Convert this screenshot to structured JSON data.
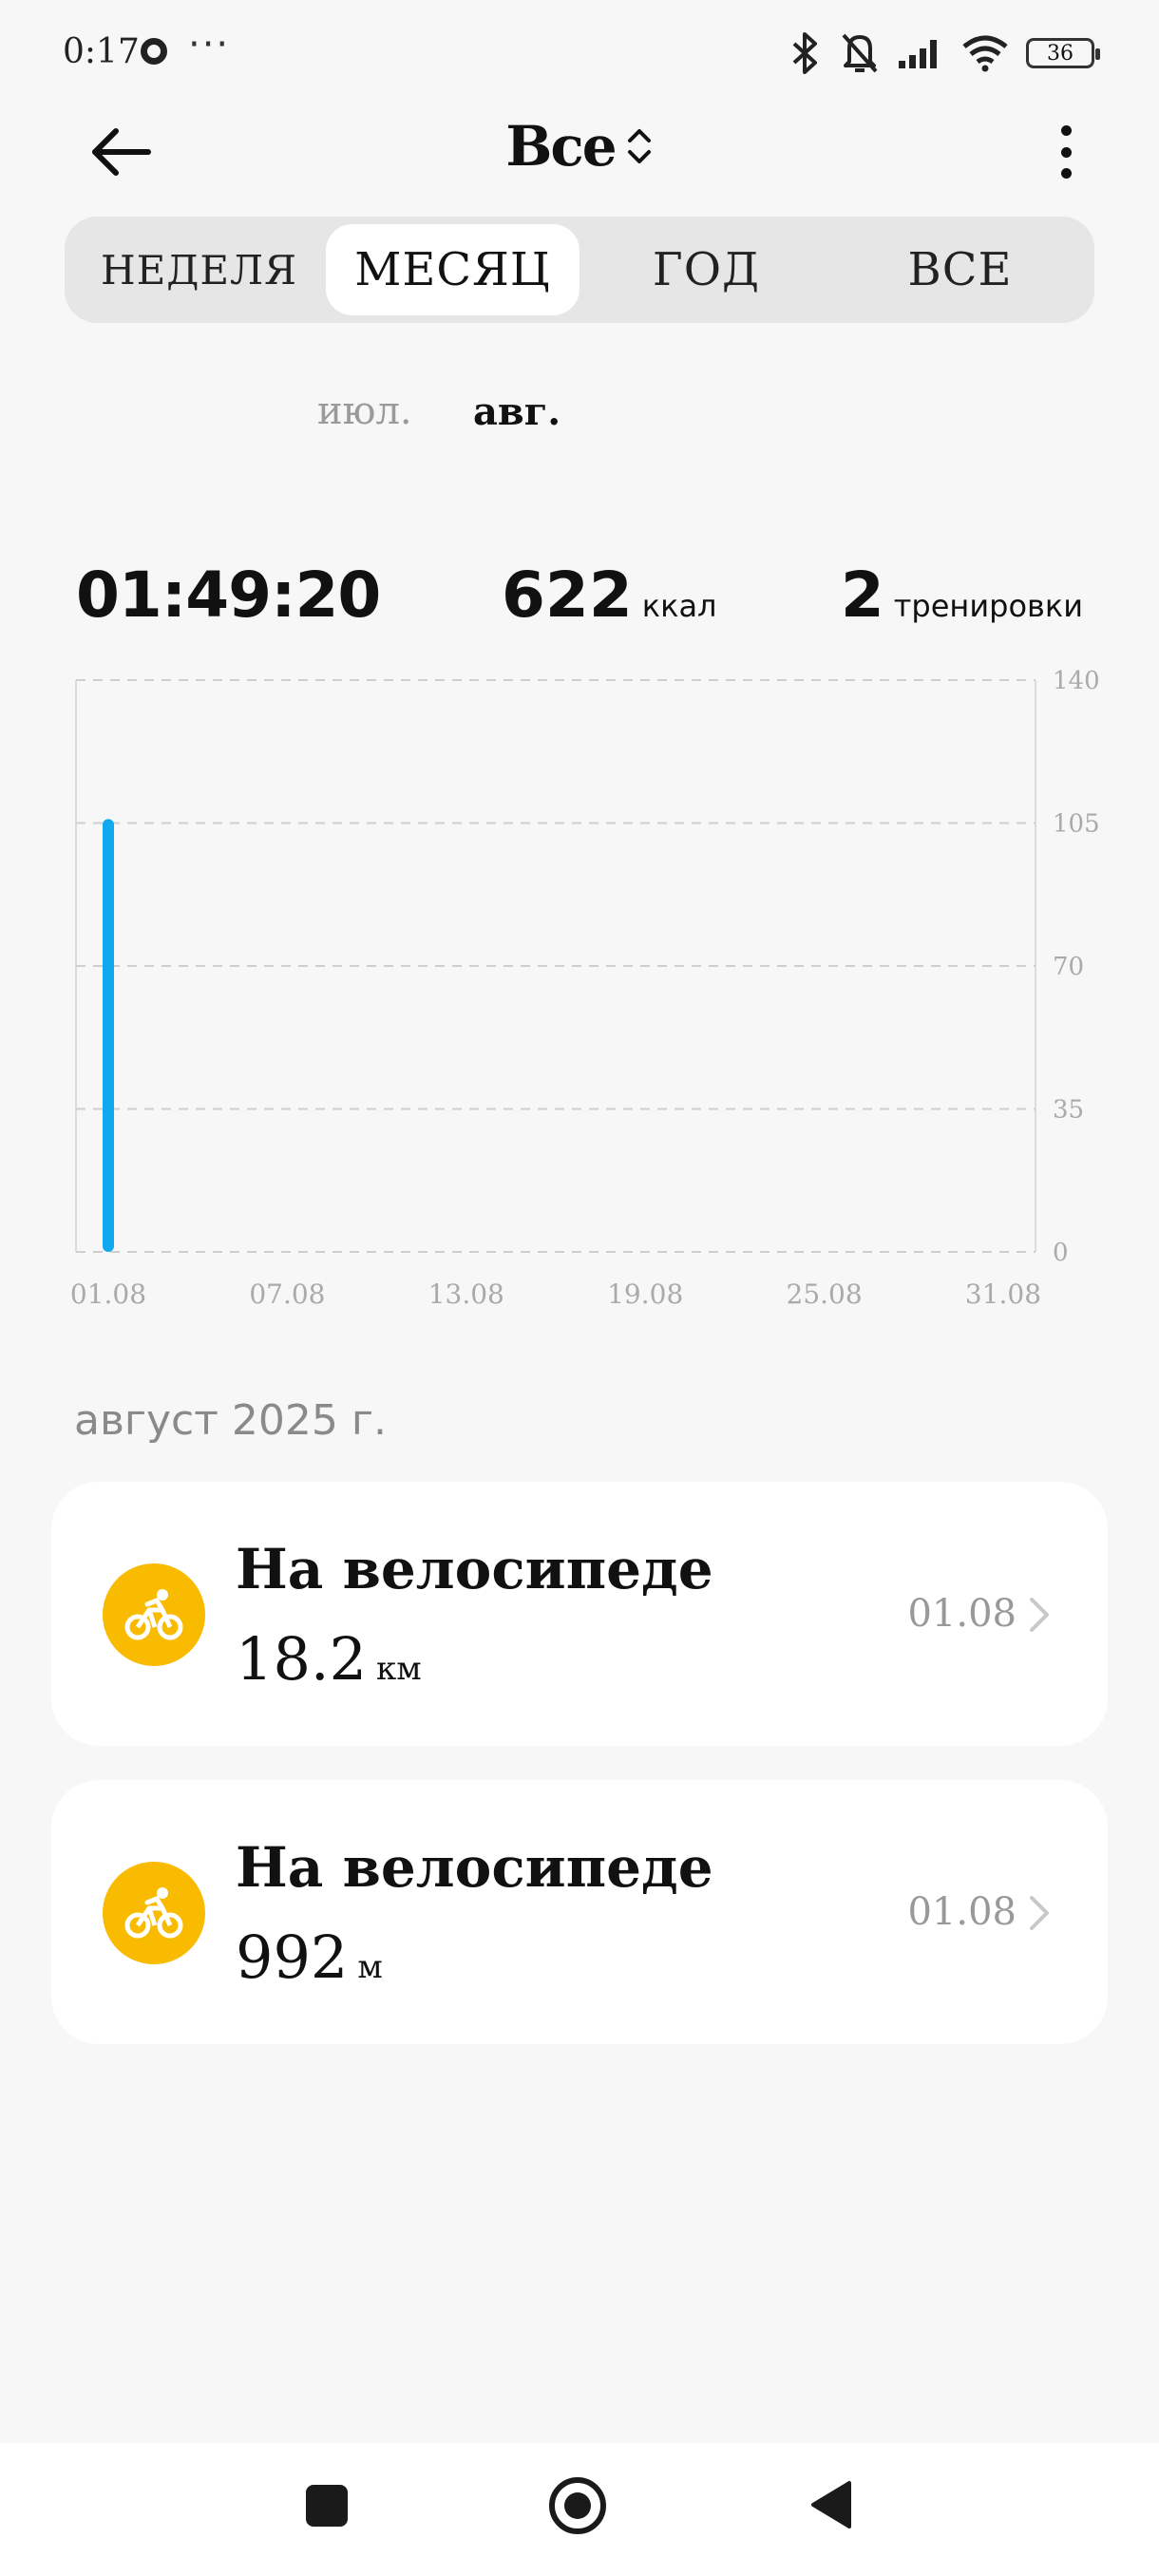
{
  "status_bar": {
    "time": "0:17",
    "more": "···",
    "battery": "36",
    "icons": [
      "bluetooth-icon",
      "bell-off-icon",
      "signal-icon",
      "wifi-icon",
      "battery-icon"
    ]
  },
  "header": {
    "title": "Все",
    "icons": [
      "back-arrow-icon",
      "sort-chevrons-icon",
      "more-vertical-icon"
    ]
  },
  "tabs": [
    {
      "label": "НЕДЕЛЯ",
      "active": false
    },
    {
      "label": "МЕСЯЦ",
      "active": true
    },
    {
      "label": "ГОД",
      "active": false
    },
    {
      "label": "ВСЕ",
      "active": false
    }
  ],
  "months": {
    "prev": "июл.",
    "current": "авг."
  },
  "stats": {
    "duration": "01:49:20",
    "calories": "622",
    "calories_unit": "ккал",
    "workouts": "2",
    "workouts_unit": "тренировки"
  },
  "chart_data": {
    "type": "bar",
    "categories": [
      "01.08"
    ],
    "values": [
      106
    ],
    "x_ticks": [
      "01.08",
      "07.08",
      "13.08",
      "19.08",
      "25.08",
      "31.08"
    ],
    "y_ticks": [
      0,
      35,
      70,
      105,
      140
    ],
    "ylim": [
      0,
      140
    ],
    "grid": true,
    "bar_color": "#12a8f0"
  },
  "section": {
    "label": "август 2025 г."
  },
  "activities": [
    {
      "title": "На велосипеде",
      "value": "18.2",
      "unit": "км",
      "date": "01.08",
      "icon": "bicycle-icon"
    },
    {
      "title": "На велосипеде",
      "value": "992",
      "unit": "м",
      "date": "01.08",
      "icon": "bicycle-icon"
    }
  ],
  "colors": {
    "accent_yellow": "#f9bb00",
    "chart_blue": "#12a8f0"
  }
}
